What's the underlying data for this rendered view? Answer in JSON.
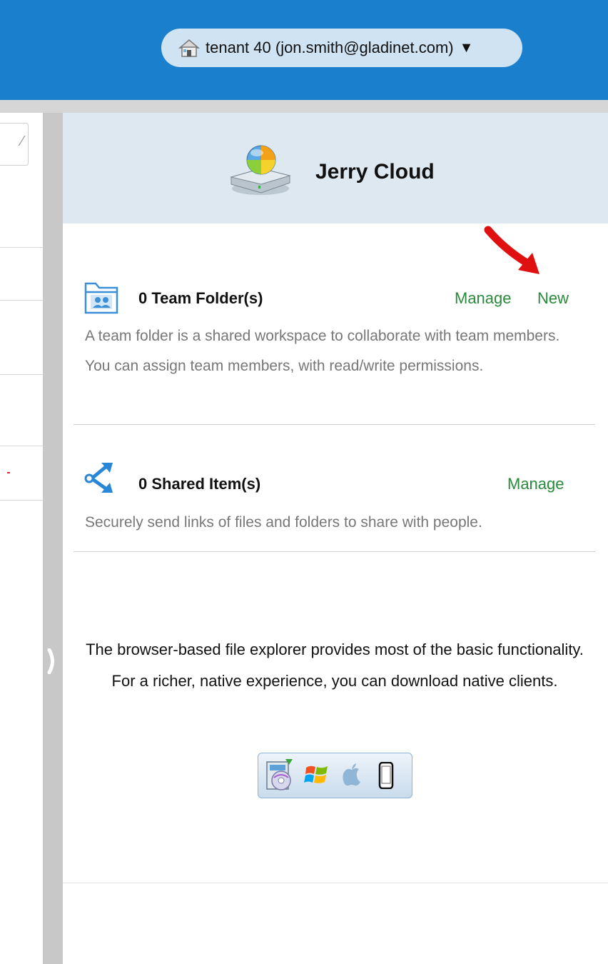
{
  "header": {
    "tenant_label": "tenant 40  (jon.smith@gladinet.com)",
    "caret": "▼",
    "home_icon": "home-icon",
    "color": "#1a7fcc"
  },
  "panel": {
    "title": "Jerry Cloud",
    "drive_icon": "cloud-drive-icon",
    "team_folders": {
      "title": "0 Team Folder(s)",
      "manage_label": "Manage",
      "new_label": "New",
      "description": "A team folder is a shared workspace to collaborate with team members. You can assign team members, with read/write permissions.",
      "icon": "team-folder-icon"
    },
    "shared_items": {
      "title": "0 Shared Item(s)",
      "manage_label": "Manage",
      "description": "Securely send links of files and folders to share with people.",
      "icon": "share-icon"
    },
    "promo_text": "The browser-based file explorer provides most of the basic functionality. For a richer, native experience, you can download native clients.",
    "client_icons": [
      "desktop-client-icon",
      "windows-icon",
      "apple-icon",
      "mobile-icon"
    ]
  },
  "colors": {
    "link_green": "#2a8a3c",
    "panel_header_bg": "#dde8f1",
    "arrow_red": "#e01010"
  }
}
